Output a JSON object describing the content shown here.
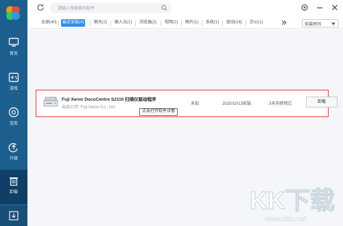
{
  "sidebar": {
    "items": [
      {
        "label": "首页",
        "icon": "monitor-icon"
      },
      {
        "label": "游戏",
        "icon": "gamepad-icon"
      },
      {
        "label": "宝库",
        "icon": "treasure-icon"
      },
      {
        "label": "升级",
        "icon": "upgrade-icon"
      },
      {
        "label": "卸载",
        "icon": "trash-icon"
      }
    ]
  },
  "search": {
    "placeholder": "请输入想搜索的软件"
  },
  "tabs": [
    {
      "label": "全部(40)"
    },
    {
      "label": "最近安装(4)"
    },
    {
      "label": "聊天(2)"
    },
    {
      "label": "输入法(1)"
    },
    {
      "label": "浏览器(2)"
    },
    {
      "label": "视频(2)"
    },
    {
      "label": "图片(1)"
    },
    {
      "label": "系统(1)"
    },
    {
      "label": "驱动(18)"
    },
    {
      "label": "办公(1)"
    }
  ],
  "sort": {
    "label": "安装时间"
  },
  "row": {
    "name": "Fuji Xerox DocuCentre S2110 扫描仪驱动程序",
    "publisher": "出品公司: Fuji Xerox Co., Ltd.",
    "size": "未知",
    "date": "2020/10/13安装",
    "used": "3天内使用过",
    "uninstall": "卸载"
  },
  "tooltip": "点击打开软件详情",
  "watermark": {
    "big": "KK下载",
    "small": "www.kkx.net"
  },
  "colors": {
    "sidebar": "#1c5f8e",
    "active_tab": "#2f8ee5",
    "highlight": "#e53935"
  }
}
